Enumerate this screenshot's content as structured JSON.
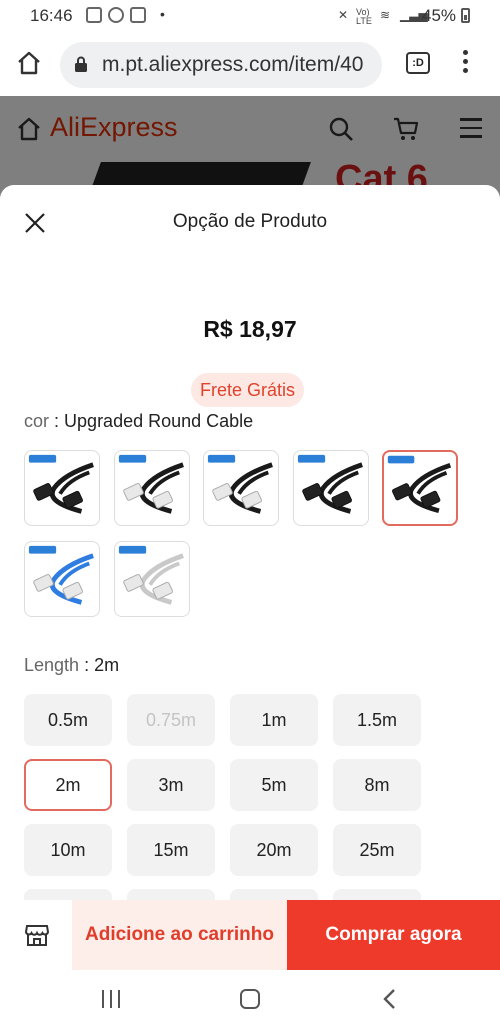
{
  "status_bar": {
    "time": "16:46",
    "battery": "45%",
    "indicators": [
      "mute-icon",
      "volte-icon",
      "wifi-icon",
      "signal-icon"
    ]
  },
  "browser": {
    "url": "m.pt.aliexpress.com/item/40",
    "tab_icon_text": ":D"
  },
  "site": {
    "logo": "AliExpress",
    "banner_text": "Cat 6"
  },
  "sheet": {
    "title": "Opção de Produto",
    "price": "R$ 18,97",
    "shipping_badge": "Frete Grátis",
    "color": {
      "key": "cor",
      "value": "Upgraded Round Cable",
      "options": [
        {
          "label": "Flat Cable",
          "cable": "#1a1a1a",
          "tag": "#2c7fd6",
          "plug": "dark",
          "selected": false
        },
        {
          "label": "Round Cable",
          "cable": "#1a1a1a",
          "tag": "#2c7fd6",
          "plug": "clear",
          "selected": false
        },
        {
          "label": "Round Cable",
          "cable": "#1a1a1a",
          "tag": "#2c7fd6",
          "plug": "clear",
          "selected": false
        },
        {
          "label": "Upgraded Flat Cable",
          "cable": "#1a1a1a",
          "tag": "#2c7fd6",
          "plug": "dark",
          "selected": false
        },
        {
          "label": "Upgraded Round Cable",
          "cable": "#1a1a1a",
          "tag": "#2c7fd6",
          "plug": "dark",
          "selected": true
        },
        {
          "label": "CAT6 Round Blue",
          "cable": "#2f7de0",
          "tag": "#2c7fd6",
          "plug": "clear",
          "selected": false
        },
        {
          "label": "CAT6 Round Grey",
          "cable": "#c9c9c9",
          "tag": "#2c7fd6",
          "plug": "clear",
          "selected": false
        }
      ]
    },
    "length": {
      "key": "Length",
      "value": "2m",
      "options": [
        {
          "label": "0.5m",
          "state": "normal"
        },
        {
          "label": "0.75m",
          "state": "disabled"
        },
        {
          "label": "1m",
          "state": "normal"
        },
        {
          "label": "1.5m",
          "state": "normal"
        },
        {
          "label": "2m",
          "state": "selected"
        },
        {
          "label": "3m",
          "state": "normal"
        },
        {
          "label": "5m",
          "state": "normal"
        },
        {
          "label": "8m",
          "state": "normal"
        },
        {
          "label": "10m",
          "state": "normal"
        },
        {
          "label": "15m",
          "state": "normal"
        },
        {
          "label": "20m",
          "state": "normal"
        },
        {
          "label": "25m",
          "state": "normal"
        },
        {
          "label": "",
          "state": "normal"
        },
        {
          "label": "",
          "state": "normal"
        },
        {
          "label": "",
          "state": "normal"
        },
        {
          "label": "",
          "state": "normal"
        }
      ]
    }
  },
  "actions": {
    "add_to_cart": "Adicione ao carrinho",
    "buy_now": "Comprar agora"
  },
  "colors": {
    "accent": "#ee3a2a",
    "accent_light": "#fdeeea",
    "selected_border": "#e36a5e",
    "option_bg": "#f2f2f2"
  }
}
